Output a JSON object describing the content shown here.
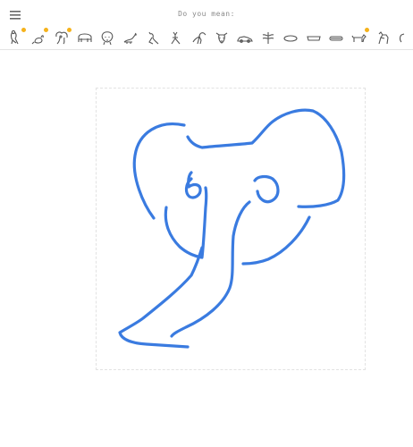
{
  "toolbar": {
    "prompt": "Do you mean:",
    "menu_icon": "hamburger-menu-icon"
  },
  "suggestions": [
    {
      "name": "kangaroo",
      "new": true
    },
    {
      "name": "mouse",
      "new": true
    },
    {
      "name": "elephant",
      "new": true
    },
    {
      "name": "cow",
      "new": false
    },
    {
      "name": "lion",
      "new": false
    },
    {
      "name": "squirrel",
      "new": false
    },
    {
      "name": "kangaroo-2",
      "new": false
    },
    {
      "name": "deer",
      "new": false
    },
    {
      "name": "dinosaur",
      "new": false
    },
    {
      "name": "bull",
      "new": false
    },
    {
      "name": "car",
      "new": false
    },
    {
      "name": "dragonfly",
      "new": false
    },
    {
      "name": "shell",
      "new": false
    },
    {
      "name": "bread-tray",
      "new": false
    },
    {
      "name": "hotdog",
      "new": false
    },
    {
      "name": "dog",
      "new": true
    },
    {
      "name": "dog-2",
      "new": false
    },
    {
      "name": "more",
      "new": false
    }
  ],
  "colors": {
    "stroke": "#3a7be0",
    "badge": "#f5b21b",
    "icon": "#555555"
  }
}
